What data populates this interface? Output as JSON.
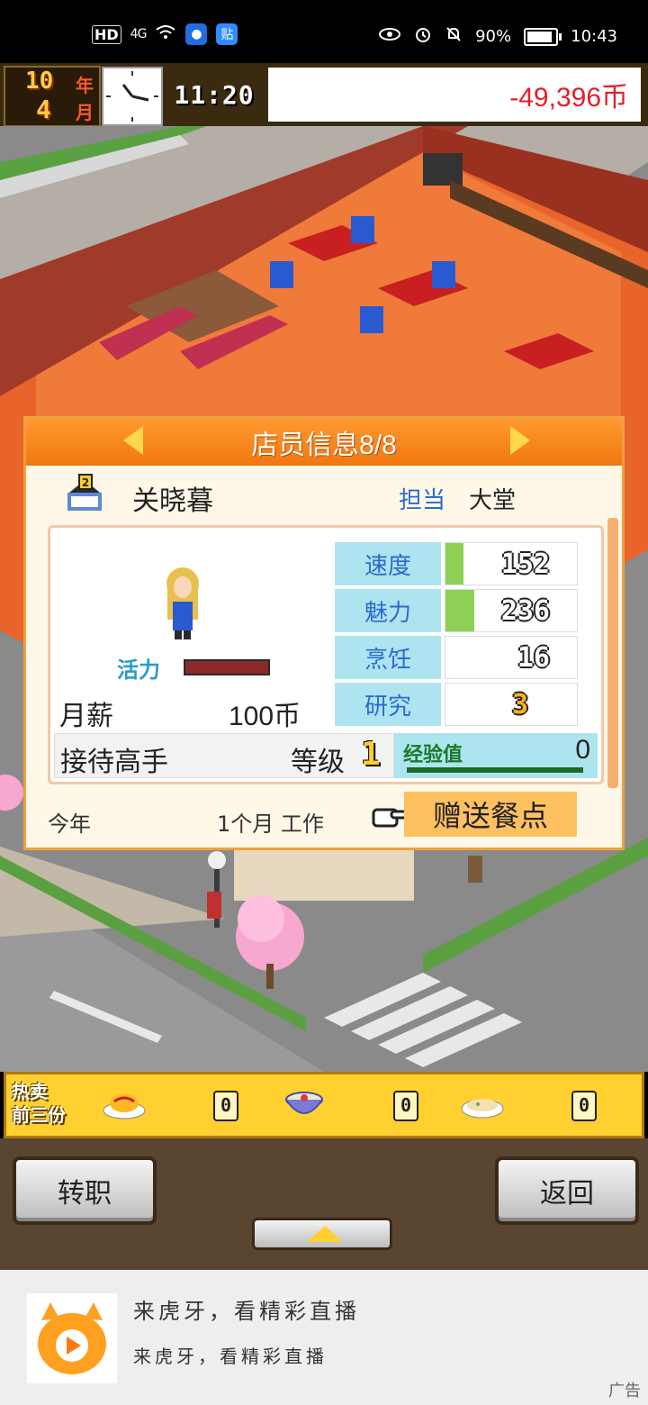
{
  "status_bar": {
    "network": "HD",
    "signal": "4G",
    "app_icon_1": "circle-app-icon",
    "app_icon_2": "贴",
    "battery": "90%",
    "time": "10:43"
  },
  "top_bar": {
    "year_num": "10",
    "year_label": "年",
    "month_num": "4",
    "month_label": "月",
    "game_time": "11:20",
    "money": "-49,396币"
  },
  "panel": {
    "title": "店员信息8/8",
    "staff_name": "关晓暮",
    "duty_label": "担当",
    "duty_value": "大堂",
    "vitality_label": "活力",
    "salary_label": "月薪",
    "salary_value": "100币",
    "skill_name": "接待高手",
    "level_label": "等级",
    "level_value": "1",
    "exp_label": "经验值",
    "exp_value": "0",
    "stats": [
      {
        "label": "速度",
        "value": "152",
        "fill": 0.14
      },
      {
        "label": "魅力",
        "value": "236",
        "fill": 0.22
      },
      {
        "label": "烹饪",
        "value": "16",
        "fill": 0
      },
      {
        "label": "研究",
        "value": "3",
        "fill": 0
      }
    ],
    "footer_year": "今年",
    "footer_months": "1个月 工作",
    "gift_button": "赠送餐点"
  },
  "hot_sellers": {
    "label_line1": "热卖",
    "label_line2": "前三份",
    "items": [
      {
        "icon": "omelette-rice-icon",
        "count": "0"
      },
      {
        "icon": "ramen-bowl-icon",
        "count": "0"
      },
      {
        "icon": "soup-bowl-icon",
        "count": "0"
      }
    ]
  },
  "buttons": {
    "change_job": "转职",
    "back": "返回"
  },
  "ad": {
    "line1": "来虎牙，看精彩直播",
    "line2": "来虎牙，看精彩直播",
    "tag": "广告"
  },
  "colors": {
    "accent_orange": "#f07810",
    "money_red": "#e0202a",
    "stat_blue": "#2a6ad0"
  }
}
